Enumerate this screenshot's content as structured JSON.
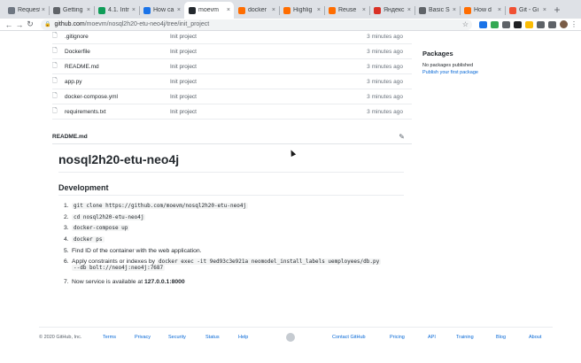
{
  "browser": {
    "tabs": [
      {
        "title": "Request",
        "color": "#6e7681"
      },
      {
        "title": "Getting",
        "color": "#5f6368"
      },
      {
        "title": "4.1. Intr",
        "color": "#0f9d58"
      },
      {
        "title": "How ca",
        "color": "#1a73e8"
      },
      {
        "title": "moevm",
        "color": "#24292e",
        "active": true
      },
      {
        "title": "docker",
        "color": "#ff6d00"
      },
      {
        "title": "Highlig",
        "color": "#ff6d00"
      },
      {
        "title": "Reuse",
        "color": "#ff6d00"
      },
      {
        "title": "Яндекс",
        "color": "#d93025"
      },
      {
        "title": "Basic S",
        "color": "#5f6368"
      },
      {
        "title": "How d",
        "color": "#ff6d00"
      },
      {
        "title": "Git - Gi",
        "color": "#f05032"
      }
    ],
    "new_tab_label": "+",
    "close_glyph": "×",
    "url_host": "github.com",
    "url_path": "/moevm/nosql2h20-etu-neo4j/tree/init_project",
    "extension_colors": [
      "#1a73e8",
      "#34a853",
      "#5f6368",
      "#202124",
      "#fbbc04",
      "#5f6368",
      "#5f6368"
    ]
  },
  "files": [
    {
      "name": ".gitignore",
      "message": "Init project",
      "age": "3 minutes ago"
    },
    {
      "name": "Dockerfile",
      "message": "Init project",
      "age": "3 minutes ago"
    },
    {
      "name": "README.md",
      "message": "Init project",
      "age": "3 minutes ago"
    },
    {
      "name": "app.py",
      "message": "Init project",
      "age": "3 minutes ago"
    },
    {
      "name": "docker-compose.yml",
      "message": "Init project",
      "age": "3 minutes ago"
    },
    {
      "name": "requirements.txt",
      "message": "Init project",
      "age": "3 minutes ago"
    }
  ],
  "sidebar": {
    "packages_title": "Packages",
    "no_packages": "No packages published",
    "publish_link": "Publish your first package"
  },
  "readme": {
    "filename": "README.md",
    "title": "nosql2h20-etu-neo4j",
    "section": "Development",
    "steps": [
      {
        "num": "1.",
        "code": "git clone https://github.com/moevm/nosql2h20-etu-neo4j"
      },
      {
        "num": "2.",
        "code": "cd nosql2h20-etu-neo4j"
      },
      {
        "num": "3.",
        "code": "docker-compose up"
      },
      {
        "num": "4.",
        "code": "docker ps"
      },
      {
        "num": "5.",
        "text": "Find ID of the container with the web application."
      },
      {
        "num": "6.",
        "text": "Apply constraints or indexes by",
        "code": "docker exec -it 9ed93c3e921a neomodel_install_labels uemployees/db.py",
        "code2": "--db bolt://neo4j:neo4j:7687"
      },
      {
        "num": "7.",
        "text": "Now service is available at",
        "bold": "127.0.0.1:8000"
      }
    ]
  },
  "footer": {
    "copyright": "© 2020 GitHub, Inc.",
    "links": [
      "Terms",
      "Privacy",
      "Security",
      "Status",
      "Help",
      "Contact GitHub",
      "Pricing",
      "API",
      "Training",
      "Blog",
      "About"
    ]
  }
}
